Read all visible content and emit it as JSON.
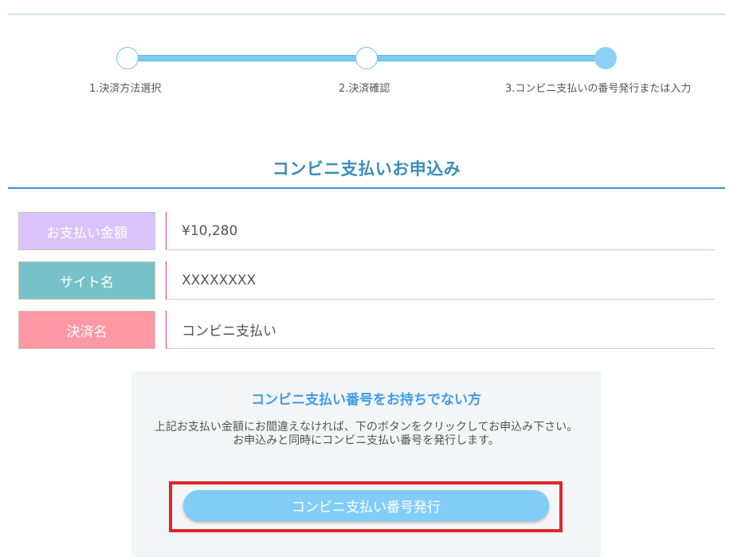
{
  "stepper": {
    "steps": [
      {
        "label": "1.決済方法選択",
        "state": "done"
      },
      {
        "label": "2.決済確認",
        "state": "done"
      },
      {
        "label": "3.コンビニ支払いの番号発行または入力",
        "state": "current"
      }
    ]
  },
  "section": {
    "title": "コンビニ支払いお申込み"
  },
  "info": {
    "rows": [
      {
        "label": "お支払い金額",
        "value": "¥10,280"
      },
      {
        "label": "サイト名",
        "value": "XXXXXXXX"
      },
      {
        "label": "決済名",
        "value": "コンビニ支払い"
      }
    ]
  },
  "panel": {
    "title": "コンビニ支払い番号をお持ちでない方",
    "text_lines": [
      "上記お支払い金額にお間違えなければ、下のボタンをクリックしてお申込み下さい。",
      "お申込みと同時にコンビニ支払い番号を発行します。"
    ],
    "button_label": "コンビニ支払い番号発行"
  },
  "colors": {
    "accent": "#3b8eb6",
    "progress": "#7ccaf1",
    "label_amount": "#d9c3fb",
    "label_site": "#77c2c9",
    "label_payment": "#fd98a4",
    "panel_title": "#3e9bea",
    "button": "#82cdf8",
    "highlight": "#e0262a"
  }
}
